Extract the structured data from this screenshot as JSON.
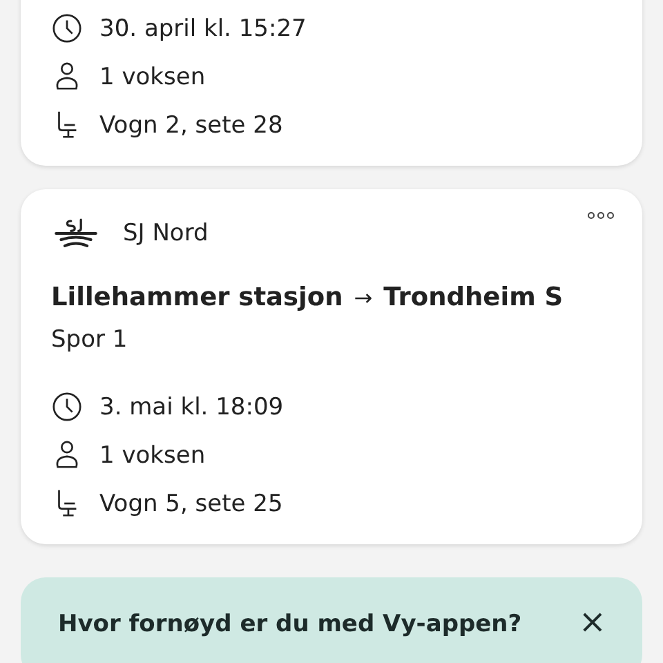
{
  "trips": [
    {
      "details": [
        {
          "kind": "time",
          "text": "30. april kl. 15:27"
        },
        {
          "kind": "passengers",
          "text": "1 voksen"
        },
        {
          "kind": "seat",
          "text": "Vogn 2, sete 28"
        }
      ]
    },
    {
      "operator": "SJ Nord",
      "from": "Lillehammer stasjon",
      "arrow": "→",
      "to": "Trondheim S",
      "platform": "Spor 1",
      "details": [
        {
          "kind": "time",
          "text": "3. mai kl. 18:09"
        },
        {
          "kind": "passengers",
          "text": "1 voksen"
        },
        {
          "kind": "seat",
          "text": "Vogn 5, sete 25"
        }
      ]
    }
  ],
  "feedback": {
    "question": "Hvor fornøyd er du med Vy-appen?",
    "close": "×"
  }
}
